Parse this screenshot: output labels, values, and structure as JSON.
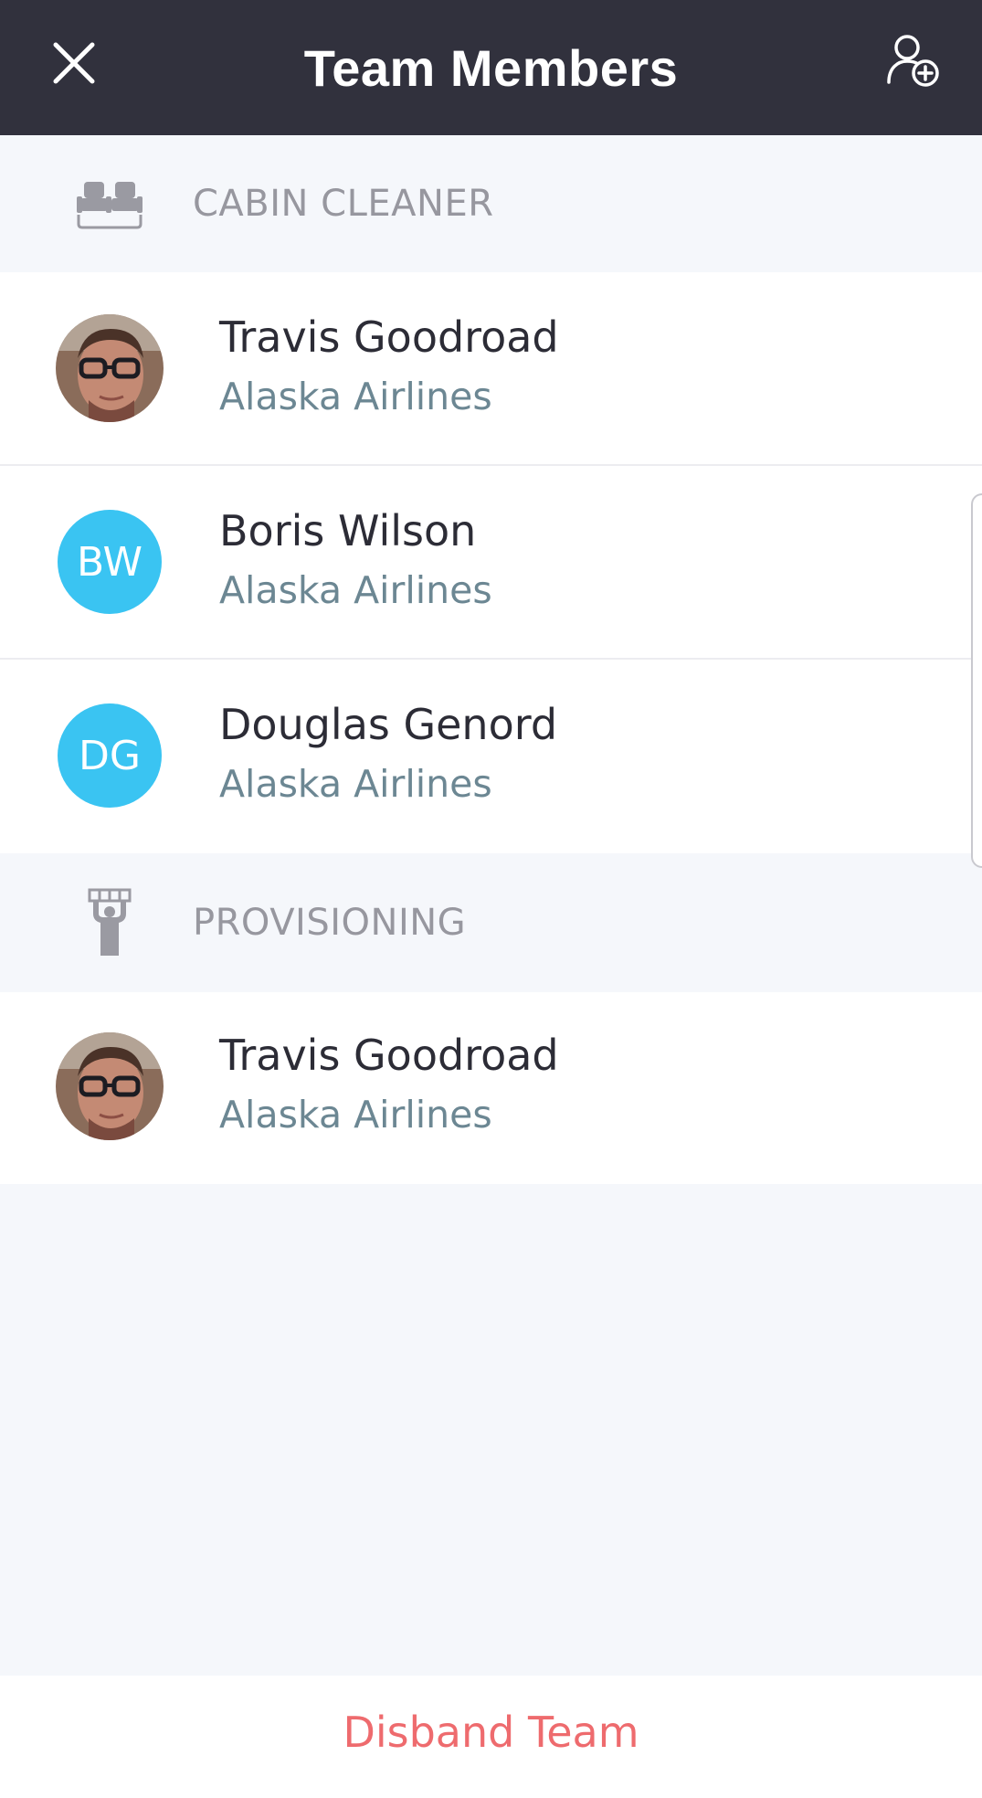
{
  "header": {
    "title": "Team Members",
    "close_icon": "close-icon",
    "add_member_icon": "add-user-icon"
  },
  "sections": [
    {
      "label": "CABIN CLEANER",
      "icon": "seats-icon",
      "members": [
        {
          "name": "Travis Goodroad",
          "org": "Alaska Airlines",
          "avatar": "photo"
        },
        {
          "name": "Boris Wilson",
          "org": "Alaska Airlines",
          "avatar": "initials",
          "initials": "BW"
        },
        {
          "name": "Douglas Genord",
          "org": "Alaska Airlines",
          "avatar": "initials",
          "initials": "DG"
        }
      ]
    },
    {
      "label": "PROVISIONING",
      "icon": "provisioning-icon",
      "members": [
        {
          "name": "Travis Goodroad",
          "org": "Alaska Airlines",
          "avatar": "photo"
        }
      ]
    }
  ],
  "footer": {
    "disband_label": "Disband Team"
  },
  "colors": {
    "header_bg": "#31313d",
    "initials_avatar_bg": "#3ac4f2",
    "section_label": "#97979f",
    "org_text": "#6c8793",
    "danger": "#ee6b6e"
  }
}
